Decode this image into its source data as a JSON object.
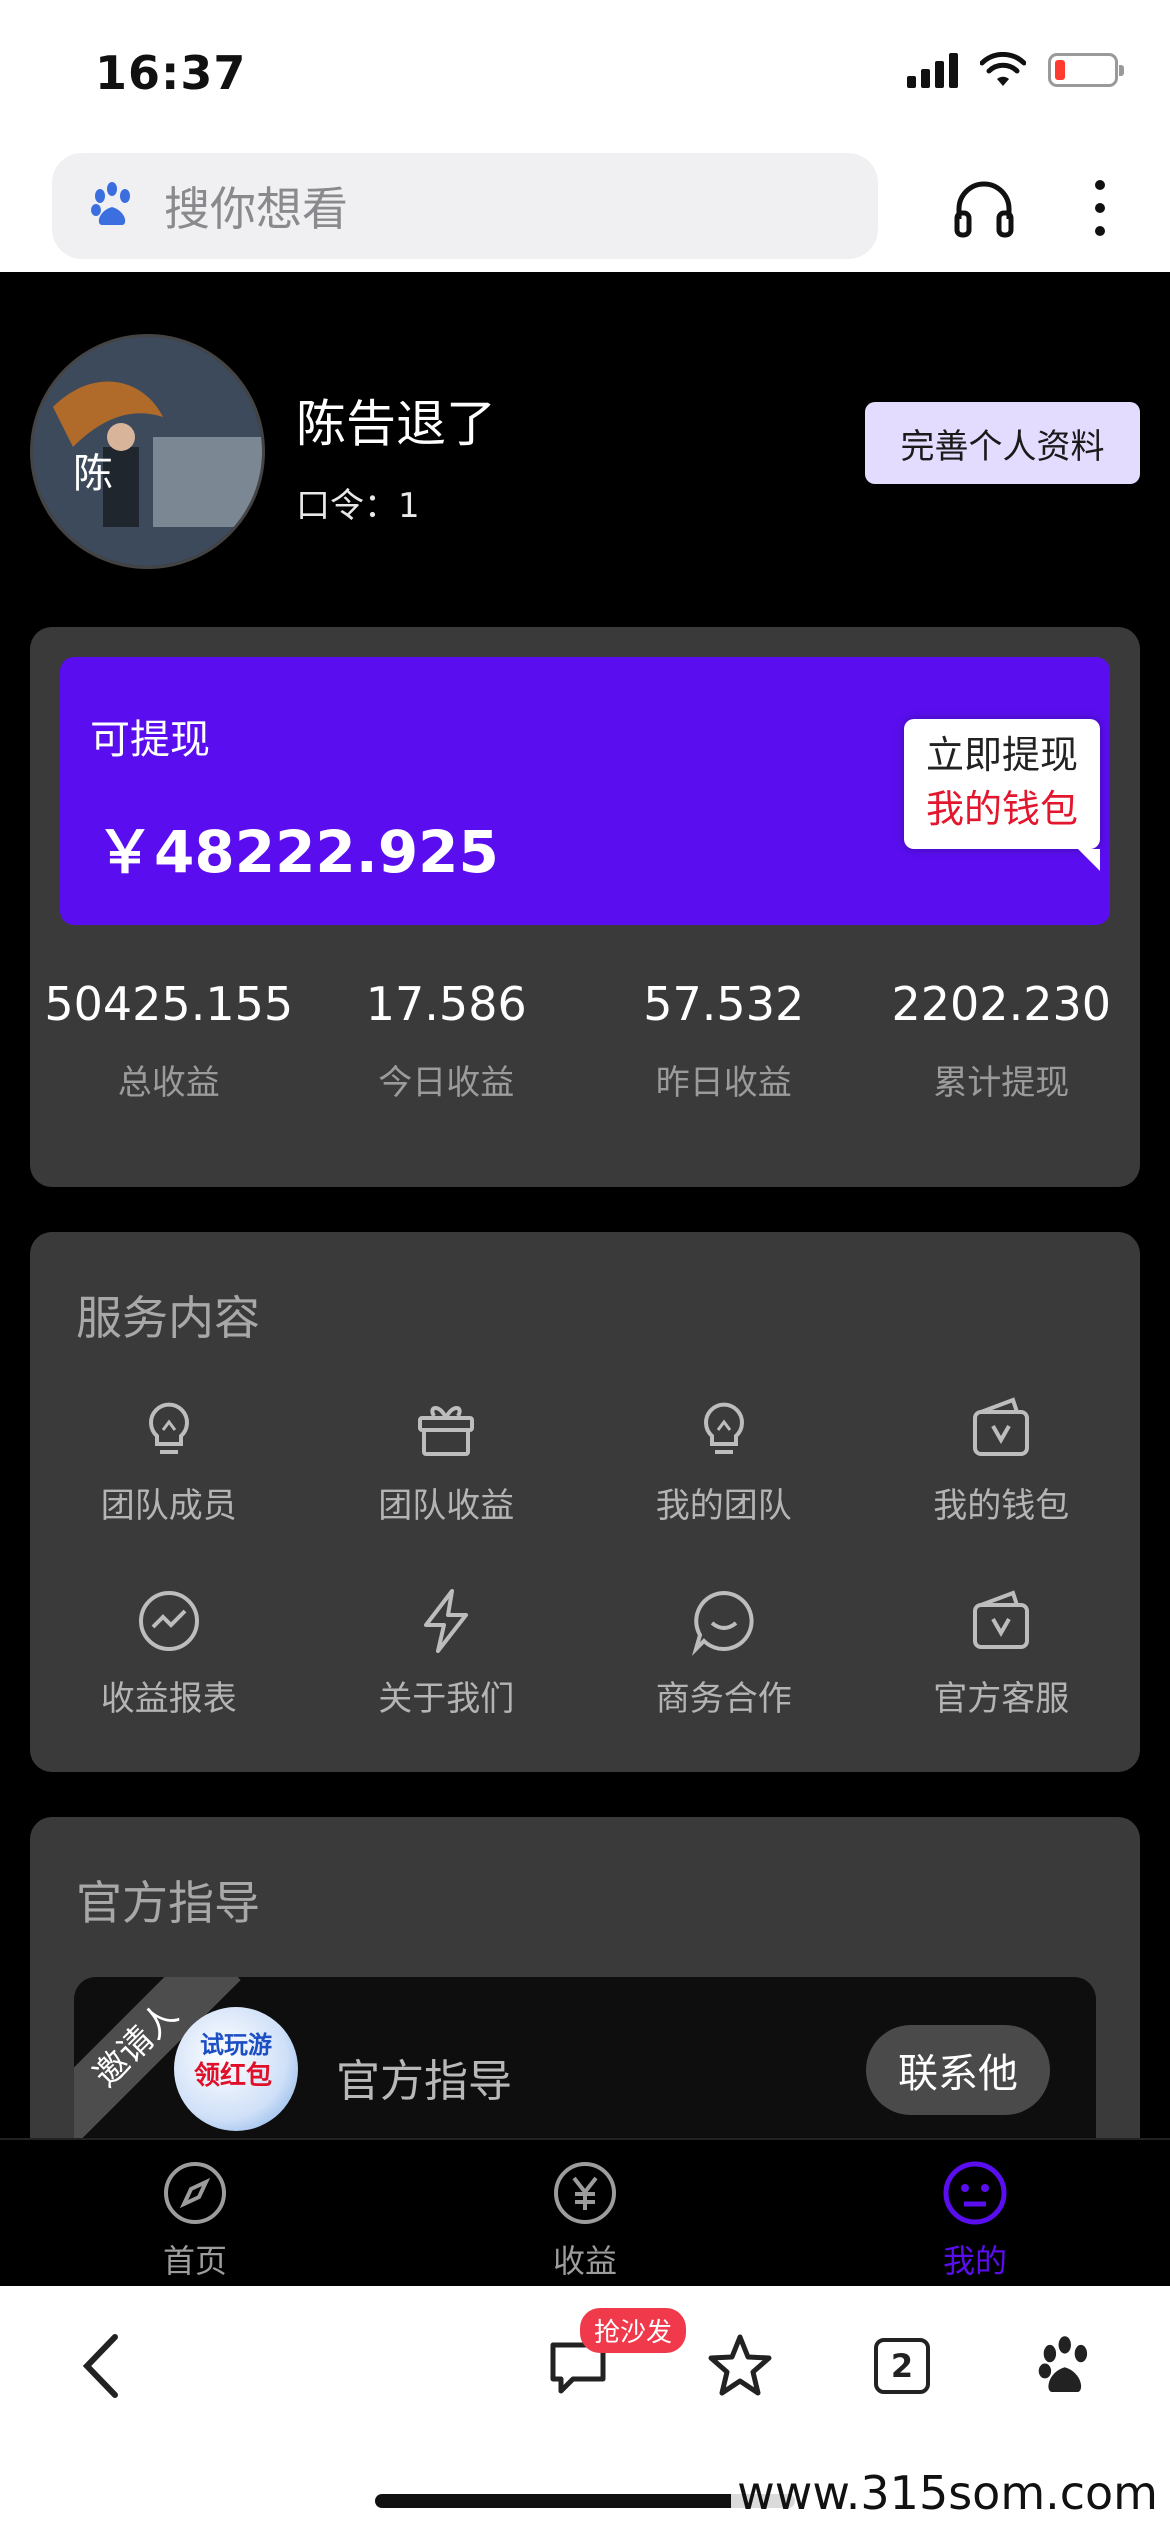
{
  "status_bar": {
    "time": "16:37"
  },
  "browser": {
    "search_placeholder": "搜你想看",
    "tabs_count": "2",
    "comment_badge": "抢沙发"
  },
  "profile": {
    "username": "陈告退了",
    "code_label": "口令：1",
    "edit_button": "完善个人资料"
  },
  "earnings": {
    "balance_label": "可提现",
    "balance_amount": "￥48222.925",
    "withdraw_line1": "立即提现",
    "withdraw_line2": "我的钱包",
    "stats": [
      {
        "value": "50425.155",
        "label": "总收益"
      },
      {
        "value": "17.586",
        "label": "今日收益"
      },
      {
        "value": "57.532",
        "label": "昨日收益"
      },
      {
        "value": "2202.230",
        "label": "累计提现"
      }
    ]
  },
  "services": {
    "title": "服务内容",
    "items": [
      {
        "label": "团队成员",
        "icon": "bulb-icon"
      },
      {
        "label": "团队收益",
        "icon": "gift-icon"
      },
      {
        "label": "我的团队",
        "icon": "bulb-icon"
      },
      {
        "label": "我的钱包",
        "icon": "wallet-icon"
      },
      {
        "label": "收益报表",
        "icon": "chart-icon"
      },
      {
        "label": "关于我们",
        "icon": "lightning-icon"
      },
      {
        "label": "商务合作",
        "icon": "chat-icon"
      },
      {
        "label": "官方客服",
        "icon": "wallet-icon"
      }
    ]
  },
  "guide": {
    "title": "官方指导",
    "ribbon": "邀请人",
    "thumb_line1": "试玩游",
    "thumb_line2": "领红包",
    "name": "官方指导",
    "contact_button": "联系他"
  },
  "app_tabs": [
    {
      "label": "首页",
      "icon": "compass-icon"
    },
    {
      "label": "收益",
      "icon": "yen-icon"
    },
    {
      "label": "我的",
      "icon": "face-icon"
    }
  ],
  "colors": {
    "accent": "#5a0ef0",
    "card": "#3a3a3a",
    "badge": "#f03a4c"
  },
  "watermark": "www.315som.com"
}
